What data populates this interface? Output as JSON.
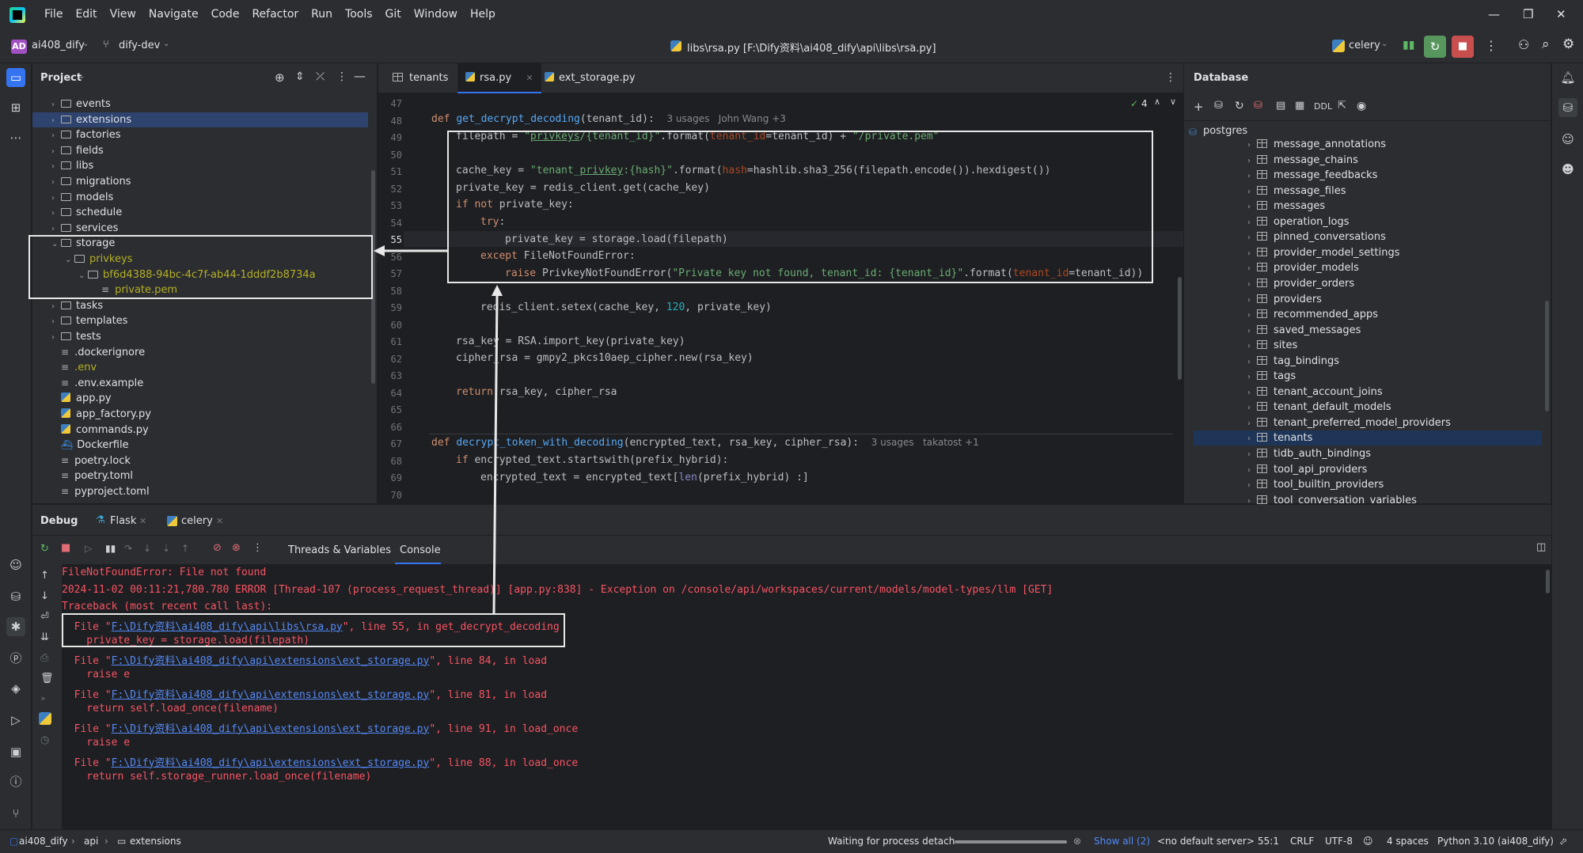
{
  "menu": [
    "File",
    "Edit",
    "View",
    "Navigate",
    "Code",
    "Refactor",
    "Run",
    "Tools",
    "Git",
    "Window",
    "Help"
  ],
  "toolbar": {
    "project_badge": "AD",
    "project_name": "ai408_dify",
    "branch": "dify-dev",
    "file_path": "libs\\rsa.py [F:\\Dify资料\\ai408_dify\\api\\libs\\rsa.py]",
    "run_config": "celery"
  },
  "project_panel": {
    "title": "Project",
    "items": [
      {
        "label": "events",
        "type": "folder",
        "indent": 0,
        "chevron": ">"
      },
      {
        "label": "extensions",
        "type": "folder",
        "indent": 0,
        "chevron": ">",
        "selected": true
      },
      {
        "label": "factories",
        "type": "folder",
        "indent": 0,
        "chevron": ">"
      },
      {
        "label": "fields",
        "type": "folder",
        "indent": 0,
        "chevron": ">"
      },
      {
        "label": "libs",
        "type": "folder",
        "indent": 0,
        "chevron": ">"
      },
      {
        "label": "migrations",
        "type": "folder",
        "indent": 0,
        "chevron": ">"
      },
      {
        "label": "models",
        "type": "folder",
        "indent": 0,
        "chevron": ">"
      },
      {
        "label": "schedule",
        "type": "folder",
        "indent": 0,
        "chevron": ">"
      },
      {
        "label": "services",
        "type": "folder",
        "indent": 0,
        "chevron": ">"
      },
      {
        "label": "storage",
        "type": "folder",
        "indent": 0,
        "chevron": "v"
      },
      {
        "label": "privkeys",
        "type": "folder",
        "indent": 1,
        "chevron": "v",
        "color": "#b5b025"
      },
      {
        "label": "bf6d4388-94bc-4c7f-ab44-1dddf2b8734a",
        "type": "folder",
        "indent": 2,
        "chevron": "v",
        "color": "#b5b025"
      },
      {
        "label": "private.pem",
        "type": "file",
        "indent": 3,
        "chevron": "",
        "color": "#b5b025"
      },
      {
        "label": "tasks",
        "type": "folder",
        "indent": 0,
        "chevron": ">"
      },
      {
        "label": "templates",
        "type": "folder",
        "indent": 0,
        "chevron": ">"
      },
      {
        "label": "tests",
        "type": "folder",
        "indent": 0,
        "chevron": ">"
      },
      {
        "label": ".dockerignore",
        "type": "file",
        "indent": 0,
        "chevron": ""
      },
      {
        "label": ".env",
        "type": "file",
        "indent": 0,
        "chevron": "",
        "color": "#b5b025"
      },
      {
        "label": ".env.example",
        "type": "file",
        "indent": 0,
        "chevron": ""
      },
      {
        "label": "app.py",
        "type": "py",
        "indent": 0,
        "chevron": ""
      },
      {
        "label": "app_factory.py",
        "type": "py",
        "indent": 0,
        "chevron": ""
      },
      {
        "label": "commands.py",
        "type": "py",
        "indent": 0,
        "chevron": ""
      },
      {
        "label": "Dockerfile",
        "type": "docker",
        "indent": 0,
        "chevron": ""
      },
      {
        "label": "poetry.lock",
        "type": "file",
        "indent": 0,
        "chevron": ""
      },
      {
        "label": "poetry.toml",
        "type": "file",
        "indent": 0,
        "chevron": ""
      },
      {
        "label": "pyproject.toml",
        "type": "file",
        "indent": 0,
        "chevron": ""
      }
    ]
  },
  "tabs": [
    {
      "label": "tenants",
      "active": false
    },
    {
      "label": "rsa.py",
      "active": true
    },
    {
      "label": "ext_storage.py",
      "active": false
    }
  ],
  "editor": {
    "inspection_count": "4",
    "line_numbers": [
      "47",
      "48",
      "49",
      "50",
      "51",
      "52",
      "53",
      "54",
      "55",
      "56",
      "57",
      "58",
      "59",
      "60",
      "61",
      "62",
      "63",
      "64",
      "65",
      "66",
      "67",
      "68",
      "69",
      "70"
    ],
    "hint1": "3 usages   John Wang +3",
    "hint2": "3 usages   takatost +1"
  },
  "database": {
    "title": "Database",
    "ddl": "DDL",
    "root": "postgres",
    "tables": [
      "message_annotations",
      "message_chains",
      "message_feedbacks",
      "message_files",
      "messages",
      "operation_logs",
      "pinned_conversations",
      "provider_model_settings",
      "provider_models",
      "provider_orders",
      "providers",
      "recommended_apps",
      "saved_messages",
      "sites",
      "tag_bindings",
      "tags",
      "tenant_account_joins",
      "tenant_default_models",
      "tenant_preferred_model_providers",
      "tenants",
      "tidb_auth_bindings",
      "tool_api_providers",
      "tool_builtin_providers",
      "tool_conversation_variables"
    ],
    "selected": "tenants"
  },
  "debug": {
    "title": "Debug",
    "tabs": [
      "Flask",
      "celery"
    ],
    "subtabs": [
      "Threads & Variables",
      "Console"
    ],
    "console": [
      "FileNotFoundError: File not found",
      "2024-11-02 00:11:21,780.780 ERROR [Thread-107 (process_request_thread)] [app.py:838] - Exception on /console/api/workspaces/current/models/model-types/llm [GET]",
      "Traceback (most recent call last):"
    ],
    "frames": [
      {
        "pre": "  File \"",
        "path": "F:\\Dify资料\\ai408_dify\\api\\libs\\rsa.py",
        "post": "\", line 55, in get_decrypt_decoding",
        "code": "    private_key = storage.load(filepath)"
      },
      {
        "pre": "  File \"",
        "path": "F:\\Dify资料\\ai408_dify\\api\\extensions\\ext_storage.py",
        "post": "\", line 84, in load",
        "code": "    raise e"
      },
      {
        "pre": "  File \"",
        "path": "F:\\Dify资料\\ai408_dify\\api\\extensions\\ext_storage.py",
        "post": "\", line 81, in load",
        "code": "    return self.load_once(filename)"
      },
      {
        "pre": "  File \"",
        "path": "F:\\Dify资料\\ai408_dify\\api\\extensions\\ext_storage.py",
        "post": "\", line 91, in load_once",
        "code": "    raise e"
      },
      {
        "pre": "  File \"",
        "path": "F:\\Dify资料\\ai408_dify\\api\\extensions\\ext_storage.py",
        "post": "\", line 88, in load_once",
        "code": "    return self.storage_runner.load_once(filename)"
      }
    ]
  },
  "status": {
    "crumb1": "ai408_dify",
    "crumb2": "api",
    "crumb3": "extensions",
    "process": "Waiting for process detach",
    "show_all": "Show all (2)",
    "server": "<no default server>",
    "position": "55:1",
    "line_sep": "CRLF",
    "encoding": "UTF-8",
    "indent": "4 spaces",
    "interpreter": "Python 3.10 (ai408_dify)"
  }
}
